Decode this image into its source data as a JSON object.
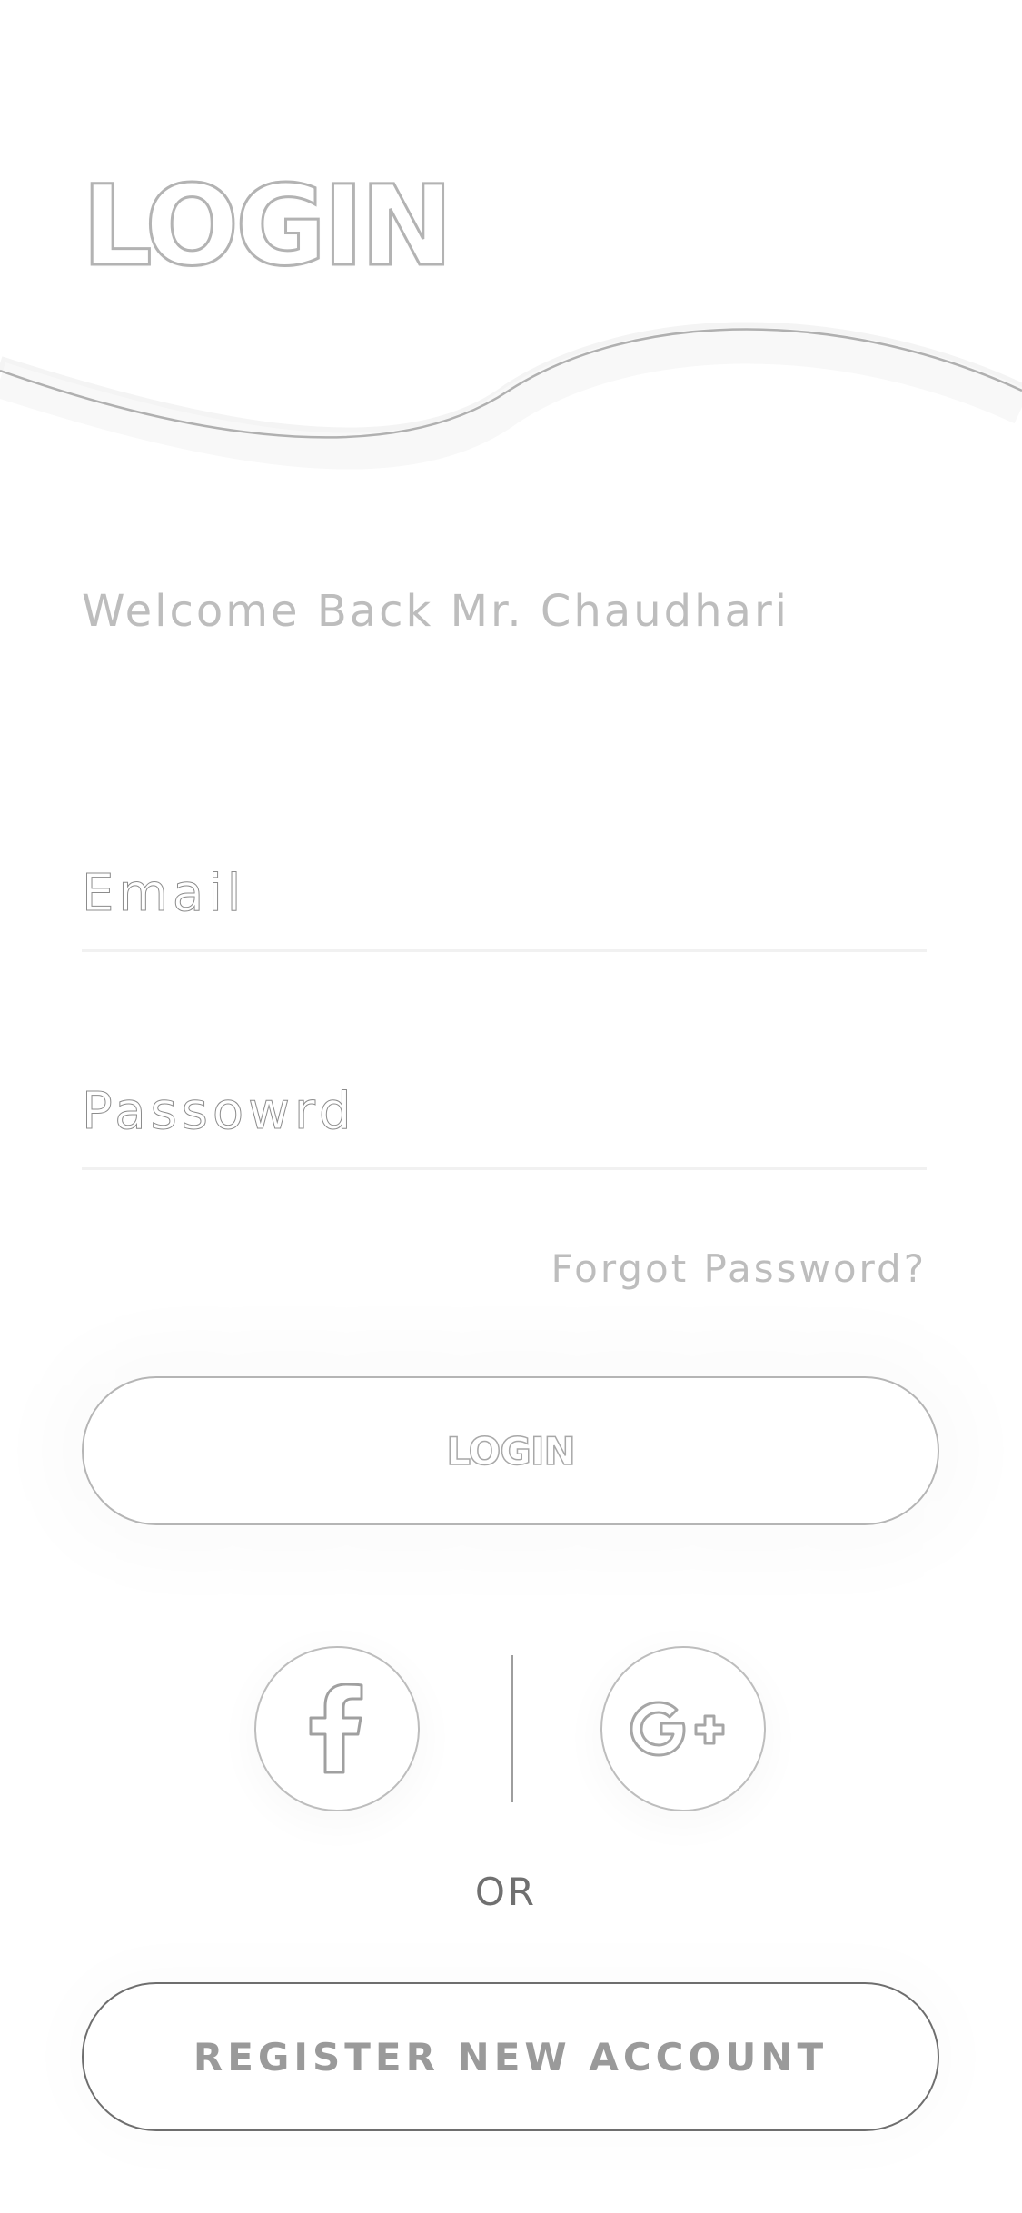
{
  "header": {
    "title": "LOGIN"
  },
  "welcome": {
    "text": "Welcome Back Mr. Chaudhari"
  },
  "form": {
    "email": {
      "placeholder": "Email",
      "value": ""
    },
    "password": {
      "placeholder": "Passowrd",
      "value": ""
    },
    "forgot_label": "Forgot Password?",
    "login_label": "LOGIN"
  },
  "social": {
    "facebook_icon": "facebook-icon",
    "google_icon": "google-plus-icon"
  },
  "or_label": "OR",
  "register_label": "REGISTER NEW ACCOUNT",
  "colors": {
    "background": "#ffffff",
    "outline": "#b3b3b3",
    "muted_text": "#bdbdbd",
    "dark_border": "#6e6e6e"
  }
}
